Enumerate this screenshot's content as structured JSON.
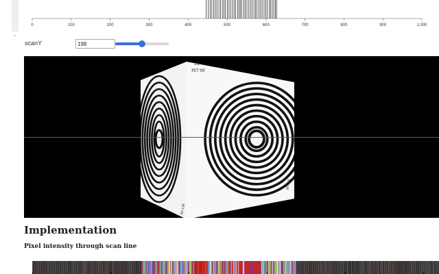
{
  "strip_plot": {
    "axis_ticks": [
      "0",
      "100",
      "200",
      "300",
      "400",
      "500",
      "600",
      "700",
      "800",
      "900",
      "1,000"
    ],
    "domain": [
      0,
      1000
    ],
    "marks": [
      446,
      452,
      457,
      461,
      466,
      470,
      474,
      479,
      483,
      488,
      492,
      496,
      501,
      505,
      509,
      514,
      518,
      522,
      527,
      531,
      534,
      538,
      543,
      547,
      551,
      556,
      560,
      564,
      569,
      573,
      577,
      582,
      586,
      590,
      595,
      599,
      603,
      608,
      612,
      616,
      620,
      624,
      627
    ]
  },
  "scan_control": {
    "label": "scanY",
    "value": "198",
    "min": 0,
    "max": 400,
    "current": 198
  },
  "canvas": {
    "scan_y_fraction": 0.5,
    "labels": {
      "top_left": "77",
      "top_left_sub": "3R-138",
      "bottom_left": "3R-138",
      "right_side": "3R-138"
    }
  },
  "implementation": {
    "heading": "Implementation",
    "subheading": "Pixel intensity through scan line"
  },
  "colors": {
    "accent": "#3d6fd6",
    "scanline": "#cc2b2b",
    "canvas_bg": "#000000"
  },
  "icons": {
    "gutter": "collapse-chevron-icon"
  }
}
